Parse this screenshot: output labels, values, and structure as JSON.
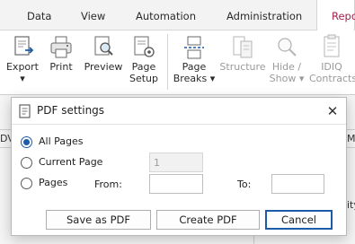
{
  "ribbon_tabs": [
    {
      "label": "Data"
    },
    {
      "label": "View"
    },
    {
      "label": "Automation"
    },
    {
      "label": "Administration"
    },
    {
      "label": "Repo"
    }
  ],
  "ribbon_buttons": {
    "export": {
      "label": "Export",
      "caret": "▾",
      "icon": "export-icon"
    },
    "print": {
      "label": "Print",
      "icon": "printer-icon"
    },
    "preview": {
      "label": "Preview",
      "icon": "preview-icon"
    },
    "page_setup": {
      "label1": "Page",
      "label2": "Setup",
      "icon": "page-setup-icon"
    },
    "page_breaks": {
      "label1": "Page",
      "label2": "Breaks",
      "caret": "▾",
      "icon": "page-breaks-icon"
    },
    "structure": {
      "label": "Structure",
      "icon": "structure-icon"
    },
    "hide_show": {
      "label1": "Hide /",
      "label2": "Show",
      "caret": "▾",
      "icon": "hide-show-icon"
    },
    "idiq": {
      "label1": "IDIQ",
      "label2": "Contracts",
      "icon": "idiq-contracts-icon"
    }
  },
  "background": {
    "left_fragment": "DV",
    "right_fragment": "M",
    "right_fragment_2": "ity"
  },
  "dialog": {
    "title": "PDF settings",
    "title_icon": "pdf-settings-icon",
    "close_glyph": "✕",
    "options": {
      "all_pages": "All Pages",
      "current_page": "Current Page",
      "pages": "Pages"
    },
    "selected_option": "all_pages",
    "current_page_value": "1",
    "from_label": "From:",
    "from_value": "",
    "to_label": "To:",
    "to_value": "",
    "buttons": {
      "save_as_pdf": "Save as PDF",
      "create_pdf": "Create PDF",
      "cancel": "Cancel"
    }
  },
  "colors": {
    "accent": "#1d5aa8",
    "active_tab_text": "#a0224e"
  }
}
